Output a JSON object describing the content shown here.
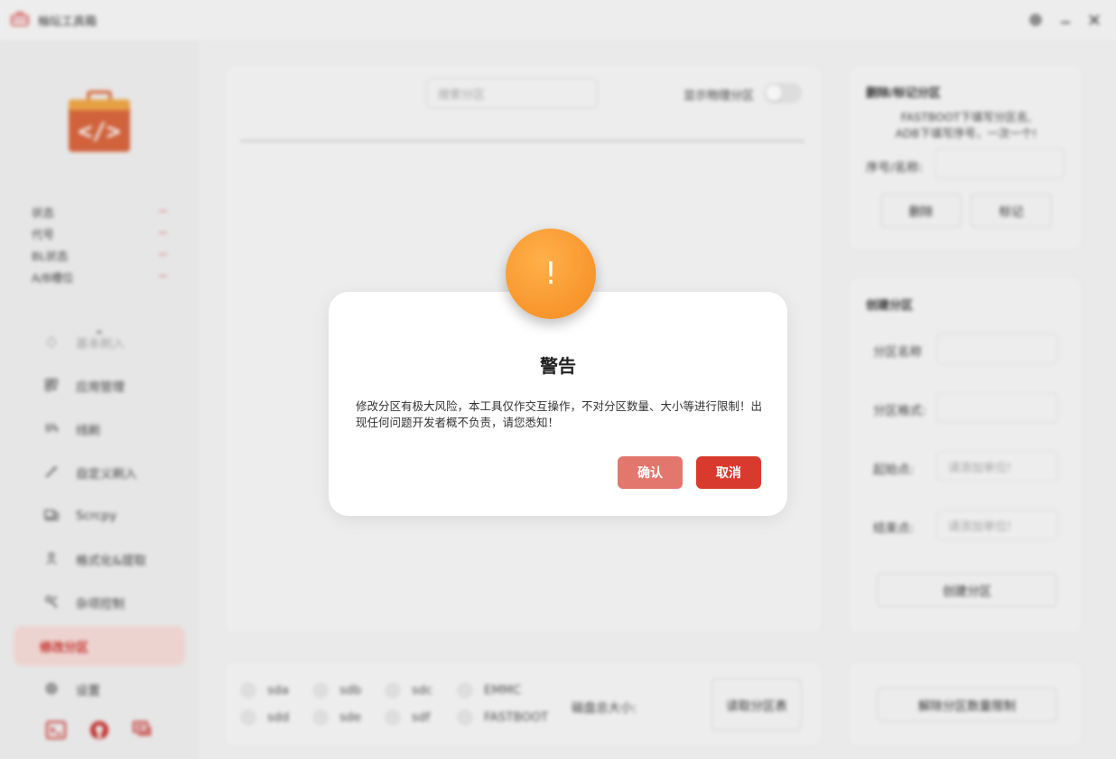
{
  "window": {
    "title": "柚坛工具箱"
  },
  "device_info": [
    {
      "label": "状态",
      "value": "--"
    },
    {
      "label": "代号",
      "value": "--"
    },
    {
      "label": "BL状态",
      "value": "--"
    },
    {
      "label": "A/B槽位",
      "value": "--"
    }
  ],
  "nav": {
    "items": [
      {
        "label": "基本刷入",
        "icon": "flash-icon"
      },
      {
        "label": "应用管理",
        "icon": "apps-icon"
      },
      {
        "label": "线刷",
        "icon": "usb-icon"
      },
      {
        "label": "自定义刷入",
        "icon": "wand-icon"
      },
      {
        "label": "Scrcpy",
        "icon": "screen-mirror-icon"
      },
      {
        "label": "格式化&提取",
        "icon": "user-icon"
      },
      {
        "label": "杂项控制",
        "icon": "tools-icon"
      },
      {
        "label": "修改分区",
        "icon": ""
      },
      {
        "label": "设置",
        "icon": "gear-icon"
      }
    ],
    "active_index": 7
  },
  "main": {
    "search_placeholder": "搜索分区",
    "show_physical_label": "显示物理分区",
    "show_physical_enabled": false
  },
  "delete_panel": {
    "title": "删除/标记分区",
    "hint_line1": "FASTBOOT下填写分区名,",
    "hint_line2": "ADB下填写序号，一次一个!",
    "field_label": "序号/名称:",
    "delete_button": "删除",
    "mark_button": "标记"
  },
  "create_panel": {
    "title": "创建分区",
    "name_label": "分区名称",
    "format_label": "分区格式:",
    "start_label": "起始点:",
    "start_placeholder": "请添加单位!",
    "end_label": "结束点:",
    "end_placeholder": "请添加单位!",
    "create_button": "创建分区"
  },
  "disks": {
    "options": [
      "sda",
      "sdb",
      "sdc",
      "EMMC",
      "sdd",
      "sde",
      "sdf",
      "FASTBOOT"
    ],
    "size_label": "磁盘总大小:",
    "read_button": "读取分区表"
  },
  "unlock_button": "解除分区数量限制",
  "dialog": {
    "badge": "!",
    "title": "警告",
    "message": "修改分区有极大风险，本工具仅作交互操作，不对分区数量、大小等进行限制！出现任何问题开发者概不负责，请您悉知！",
    "confirm": "确认",
    "cancel": "取消"
  },
  "colors": {
    "accent": "#d93a2e",
    "warning": "#f58a1f",
    "confirm": "#e3766d"
  }
}
